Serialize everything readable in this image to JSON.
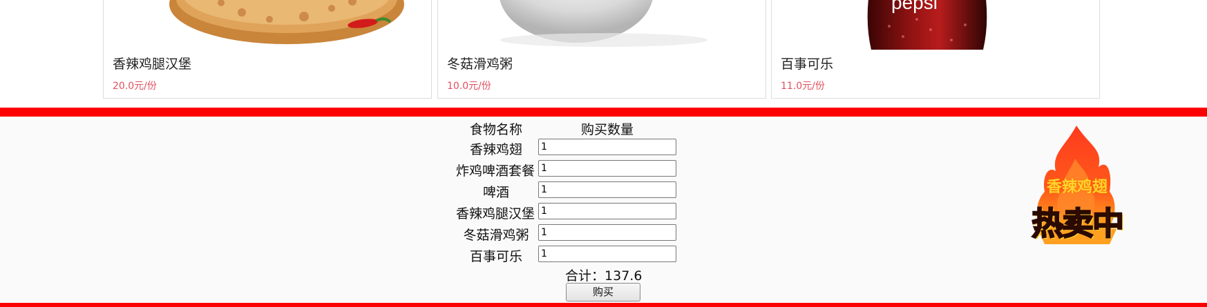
{
  "products": [
    {
      "name": "香辣鸡腿汉堡",
      "price": "20.0元/份",
      "image": "burger-image"
    },
    {
      "name": "冬菇滑鸡粥",
      "price": "10.0元/份",
      "image": "porridge-image"
    },
    {
      "name": "百事可乐",
      "price": "11.0元/份",
      "image": "pepsi-bottle-image",
      "brand_text": "pepsi"
    }
  ],
  "order": {
    "header_food": "食物名称",
    "header_qty": "购买数量",
    "items": [
      {
        "name": "香辣鸡翅",
        "qty": "1"
      },
      {
        "name": "炸鸡啤酒套餐",
        "qty": "1"
      },
      {
        "name": "啤酒",
        "qty": "1"
      },
      {
        "name": "香辣鸡腿汉堡",
        "qty": "1"
      },
      {
        "name": "冬菇滑鸡粥",
        "qty": "1"
      },
      {
        "name": "百事可乐",
        "qty": "1"
      }
    ],
    "total_label": "合计：",
    "total_value": "137.6",
    "buy_label": "购买"
  },
  "badge": {
    "top_text": "香辣鸡翅",
    "main_text": "热卖中"
  },
  "colors": {
    "accent_red": "#ff0000",
    "price_color": "#e0505e"
  }
}
